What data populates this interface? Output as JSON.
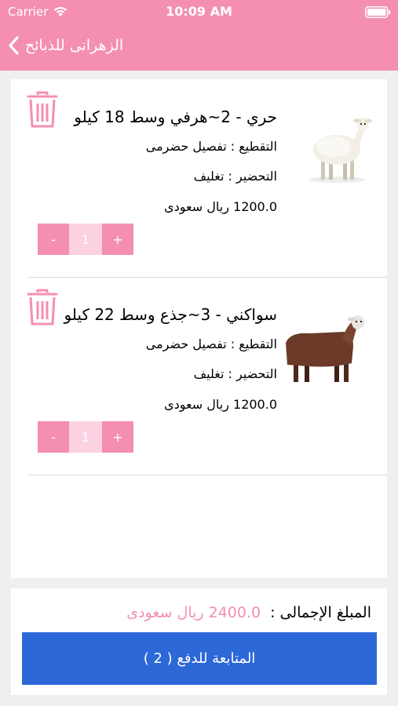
{
  "status_bar": {
    "carrier": "Carrier",
    "time": "10:09 AM",
    "wifi_icon": "wifi-icon",
    "battery_icon": "battery-icon"
  },
  "nav": {
    "back_icon": "chevron-left-icon",
    "title": "الزهرانى للذبائح"
  },
  "cart": {
    "items": [
      {
        "title": "حري - 2~هرفي وسط 18 كيلو",
        "cutting": "التقطيع : تفصيل حضرمى",
        "preparation": "التحضير : تغليف",
        "price": "1200.0 ريال سعودى",
        "quantity": "1",
        "minus_label": "-",
        "plus_label": "+",
        "image": "white-sheep"
      },
      {
        "title": "سواكني - 3~جذع وسط 22 كيلو",
        "cutting": "التقطيع : تفصيل حضرمى",
        "preparation": "التحضير : تغليف",
        "price": "1200.0 ريال سعودى",
        "quantity": "1",
        "minus_label": "-",
        "plus_label": "+",
        "image": "brown-sheep"
      }
    ]
  },
  "summary": {
    "total_label": "المبلغ الإجمالى :",
    "total_value": "2400.0 ريال سعودى",
    "checkout_label": "المتابعة للدفع ( 2 )"
  },
  "colors": {
    "brand_pink": "#f48fb1",
    "light_pink": "#fcd2e3",
    "checkout_blue": "#2d68d8",
    "background": "#efefef"
  }
}
